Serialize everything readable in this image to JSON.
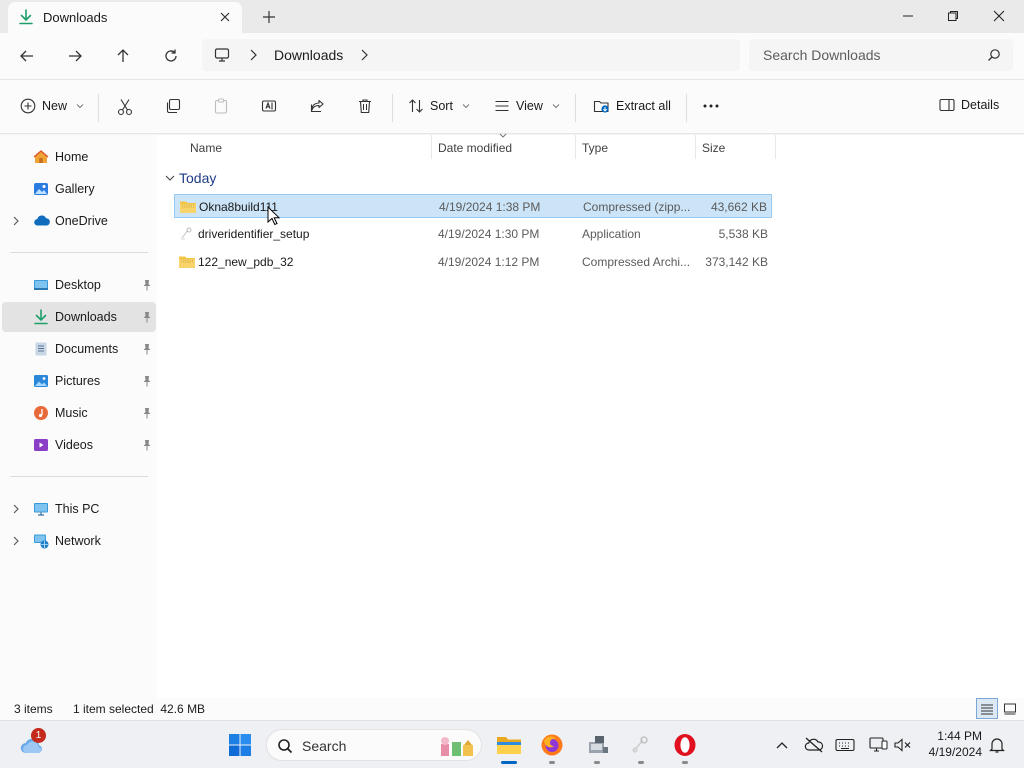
{
  "window": {
    "tab_title": "Downloads",
    "new_tab_symbol": "+"
  },
  "address": {
    "crumbs": [
      "Downloads"
    ],
    "search_placeholder": "Search Downloads"
  },
  "commands": {
    "new_label": "New",
    "sort_label": "Sort",
    "view_label": "View",
    "extract_label": "Extract all",
    "more_label": "...",
    "details_label": "Details"
  },
  "nav": {
    "top": [
      {
        "label": "Home",
        "icon": "home-icon"
      },
      {
        "label": "Gallery",
        "icon": "gallery-icon"
      },
      {
        "label": "OneDrive",
        "icon": "onedrive-icon"
      }
    ],
    "quick": [
      {
        "label": "Desktop",
        "icon": "desktop-icon"
      },
      {
        "label": "Downloads",
        "icon": "downloads-icon",
        "selected": true
      },
      {
        "label": "Documents",
        "icon": "documents-icon"
      },
      {
        "label": "Pictures",
        "icon": "pictures-icon"
      },
      {
        "label": "Music",
        "icon": "music-icon"
      },
      {
        "label": "Videos",
        "icon": "videos-icon"
      }
    ],
    "bottom": [
      {
        "label": "This PC",
        "icon": "this-pc-icon"
      },
      {
        "label": "Network",
        "icon": "network-icon"
      }
    ]
  },
  "columns": {
    "name": "Name",
    "date": "Date modified",
    "type": "Type",
    "size": "Size"
  },
  "group": {
    "label": "Today"
  },
  "files": [
    {
      "name": "Okna8build111",
      "date": "4/19/2024 1:38 PM",
      "type": "Compressed (zipp...",
      "size": "43,662 KB",
      "icon": "zip-folder-icon",
      "selected": true
    },
    {
      "name": "driveridentifier_setup",
      "date": "4/19/2024 1:30 PM",
      "type": "Application",
      "size": "5,538 KB",
      "icon": "application-icon",
      "selected": false
    },
    {
      "name": "122_new_pdb_32",
      "date": "4/19/2024 1:12 PM",
      "type": "Compressed Archi...",
      "size": "373,142 KB",
      "icon": "zip-folder-icon",
      "selected": false
    }
  ],
  "status": {
    "item_count": "3 items",
    "selection": "1 item selected  42.6 MB"
  },
  "taskbar": {
    "search_label": "Search",
    "notification_count": "1",
    "time": "1:44 PM",
    "date": "4/19/2024"
  },
  "colors": {
    "accent": "#0067c0",
    "selection_bg": "#cce4f7",
    "selection_border": "#99c9ef",
    "folder_yellow": "#f4c542"
  }
}
